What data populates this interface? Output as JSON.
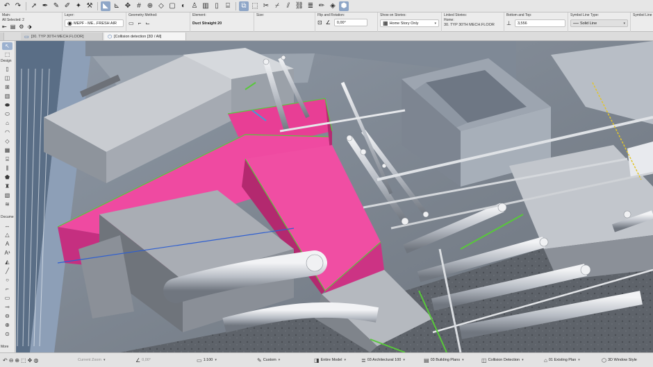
{
  "toolbar": {
    "icons": [
      "undo-icon",
      "redo-icon",
      "arrow-select-icon",
      "eyedropper-icon",
      "syringe-icon",
      "pen-icon",
      "magic-wand-icon",
      "hammer-icon",
      "snap-guide-icon",
      "snap-point-icon",
      "move-icon",
      "grid-icon",
      "zoom-icon",
      "plane-icon",
      "copy-box-icon",
      "shadow-icon",
      "figure-icon",
      "wall-icon",
      "door-icon",
      "stairs-icon",
      "railing-icon",
      "trace-icon",
      "scissors-icon",
      "trim-icon",
      "split-icon",
      "link-icon",
      "layer-icon",
      "marker-icon",
      "ruler-icon",
      "view-cube-icon"
    ]
  },
  "infobox": {
    "main_label": "Main:",
    "all_selected": "All Selected: 2",
    "layer_label": "Layer:",
    "layer_value": "MEPF - ME...FRESH AIR",
    "geometry_label": "Geometry Method:",
    "element_label": "Element:",
    "element_value": "Duct Straight 20",
    "size_label": "Size:",
    "flip_label": "Flip and Rotation:",
    "rotation_value": "0,00°",
    "show_on_stories_label": "Show on Stories:",
    "show_on_stories_value": "Home Story Only",
    "linked_stories_label": "Linked Stories:",
    "home_label": "Home:",
    "home_value": "30. TYP 30TH MECH.FLOOR",
    "bottom_top_label": "Bottom and Top:",
    "bottom_value": "3,556",
    "symbol_line_label": "Symbol Line Type:",
    "symbol_line_value": "Solid Line",
    "symbol_line_pen_label": "Symbol Line P"
  },
  "tabs": [
    {
      "label": "[30. TYP 30TH MECH.FLOOR]",
      "active": false
    },
    {
      "label": "[Collision detection [3D / All]",
      "active": true
    }
  ],
  "toolbox": {
    "design_label": "Design",
    "document_label": "Docume",
    "more_label": "More"
  },
  "statusbar": {
    "zoom_label": "Current Zoom",
    "angle": "0,00°",
    "scale": "1:100",
    "custom": "Custom",
    "model": "Entire Model",
    "layer_combo": "03 Architectural 100",
    "building_plans": "03 Building Plans",
    "collision": "Collision Detection",
    "existing_plan": "01 Existing Plan",
    "window_style": "3D Window Style"
  },
  "colors": {
    "highlight_duct": "#ec3f9b",
    "selection_edge": "#58c93a",
    "accent_blue": "#2f5fd0",
    "viewport_bg": "#a8b0b8"
  }
}
